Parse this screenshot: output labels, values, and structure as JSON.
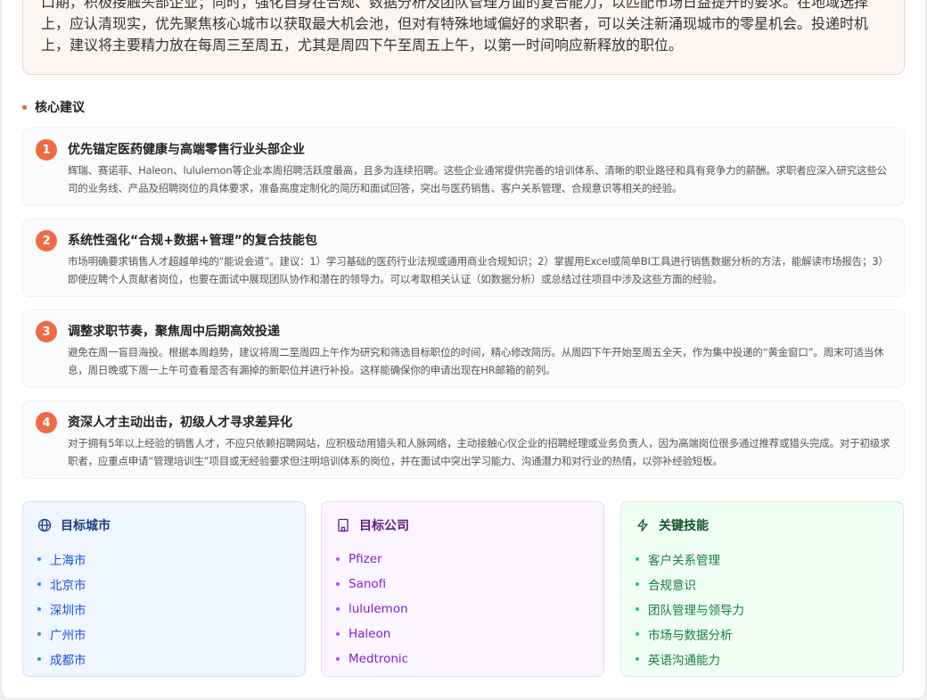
{
  "summary": {
    "line1": "口期，积极接触头部企业；同时，强化自身在合规、数据分析及团队管理方面的复合能力，以匹配市场日益提升的要求。在地域选择",
    "line2": "上，应认清现实，优先聚焦核心城市以获取最大机会池，但对有特殊地域偏好的求职者，可以关注新涌现城市的零星机会。投递时机",
    "line3": "上，建议将主要精力放在每周三至周五，尤其是周四下午至周五上午，以第一时间响应新释放的职位。"
  },
  "section_title": "核心建议",
  "recommendations": [
    {
      "num": "1",
      "title": "优先锚定医药健康与高端零售行业头部企业",
      "body": "辉瑞、赛诺菲、Haleon、lululemon等企业本周招聘活跃度最高，且多为连续招聘。这些企业通常提供完善的培训体系、清晰的职业路径和具有竞争力的薪酬。求职者应深入研究这些公司的业务线、产品及招聘岗位的具体要求，准备高度定制化的简历和面试回答，突出与医药销售、客户关系管理、合规意识等相关的经验。"
    },
    {
      "num": "2",
      "title": "系统性强化“合规+数据+管理”的复合技能包",
      "body": "市场明确要求销售人才超越单纯的“能说会道”。建议：1）学习基础的医药行业法规或通用商业合规知识；2）掌握用Excel或简单BI工具进行销售数据分析的方法，能解读市场报告；3）即使应聘个人贡献者岗位，也要在面试中展现团队协作和潜在的领导力。可以考取相关认证（如数据分析）或总结过往项目中涉及这些方面的经验。"
    },
    {
      "num": "3",
      "title": "调整求职节奏，聚焦周中后期高效投递",
      "body": "避免在周一盲目海投。根据本周趋势，建议将周二至周四上午作为研究和筛选目标职位的时间，精心修改简历。从周四下午开始至周五全天，作为集中投递的“黄金窗口”。周末可适当休息，周日晚或下周一上午可查看是否有漏掉的新职位并进行补投。这样能确保你的申请出现在HR邮箱的前列。"
    },
    {
      "num": "4",
      "title": "资深人才主动出击，初级人才寻求差异化",
      "body": "对于拥有5年以上经验的销售人才，不应只依赖招聘网站，应积极动用猎头和人脉网络，主动接触心仪企业的招聘经理或业务负责人，因为高端岗位很多通过推荐或猎头完成。对于初级求职者，应重点申请“管理培训生”项目或无经验要求但注明培训体系的岗位，并在面试中突出学习能力、沟通潜力和对行业的热情，以弥补经验短板。"
    }
  ],
  "cards": {
    "cities": {
      "title": "目标城市",
      "icon": "globe-icon",
      "items": [
        "上海市",
        "北京市",
        "深圳市",
        "广州市",
        "成都市"
      ]
    },
    "companies": {
      "title": "目标公司",
      "icon": "building-icon",
      "items": [
        "Pfizer",
        "Sanofi",
        "lululemon",
        "Haleon",
        "Medtronic"
      ]
    },
    "skills": {
      "title": "关键技能",
      "icon": "lightning-icon",
      "items": [
        "客户关系管理",
        "合规意识",
        "团队管理与领导力",
        "市场与数据分析",
        "英语沟通能力"
      ]
    }
  },
  "colors": {
    "accent": "#ee6a45",
    "blue": "#1d4ed8",
    "purple": "#7e22ce",
    "green": "#15803d"
  }
}
